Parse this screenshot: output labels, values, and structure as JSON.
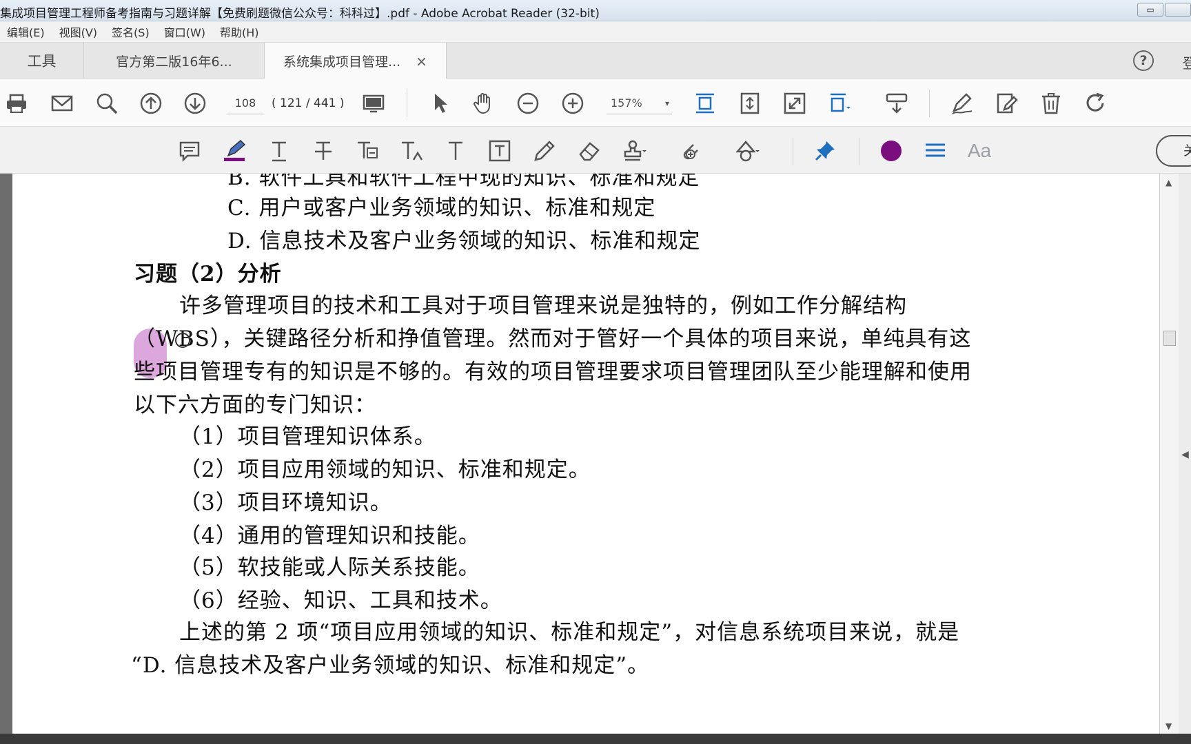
{
  "window": {
    "title": "集成项目管理工程师备考指南与习题详解【免费刷题微信公众号：科科过】.pdf - Adobe Acrobat Reader (32-bit)",
    "min_label": "▭"
  },
  "menu": {
    "items": [
      "编辑(E)",
      "视图(V)",
      "签名(S)",
      "窗口(W)",
      "帮助(H)"
    ]
  },
  "tabs": {
    "tools_label": "工具",
    "doc_tab_1": "官方第二版16年6...",
    "doc_tab_2": "系统集成项目管理...",
    "close_glyph": "×",
    "help_glyph": "?",
    "login_clip": "登"
  },
  "toolbar": {
    "page_number": "108",
    "page_count": "( 121 / 441 )",
    "zoom": "157%",
    "zoom_caret": "▾"
  },
  "comment_toolbar": {
    "close_label": "关",
    "highlight_color": "#7b0e7e",
    "font_label": "Aa"
  },
  "document": {
    "lines": [
      "B.  软件工具和软件工程中现的知识、标准和规定",
      "C.  用户或客户业务领域的知识、标准和规定",
      "D.  信息技术及客户业务领域的知识、标准和规定",
      "习题（2）分析",
      "许多管理项目的技术和工具对于项目管理来说是独特的，例如工作分解结构",
      "（WBS），关键路径分析和挣值管理。然而对于管好一个具体的项目来说，单纯具有这",
      "些项目管理专有的知识是不够的。有效的项目管理要求项目管理团队至少能理解和使用",
      "以下六方面的专门知识：",
      "（1）项目管理知识体系。",
      "（2）项目应用领域的知识、标准和规定。",
      "（3）项目环境知识。",
      "（4）通用的管理知识和技能。",
      "（5）软技能或人际关系技能。",
      "（6）经验、知识、工具和技术。",
      "上述的第 2 项“项目应用领域的知识、标准和规定”，对信息系统项目来说，就是",
      "“D.  信息技术及客户业务领域的知识、标准和规定”。"
    ]
  },
  "scroll": {
    "up": "▲",
    "down": "▼",
    "left": "◀",
    "right": "◀"
  }
}
